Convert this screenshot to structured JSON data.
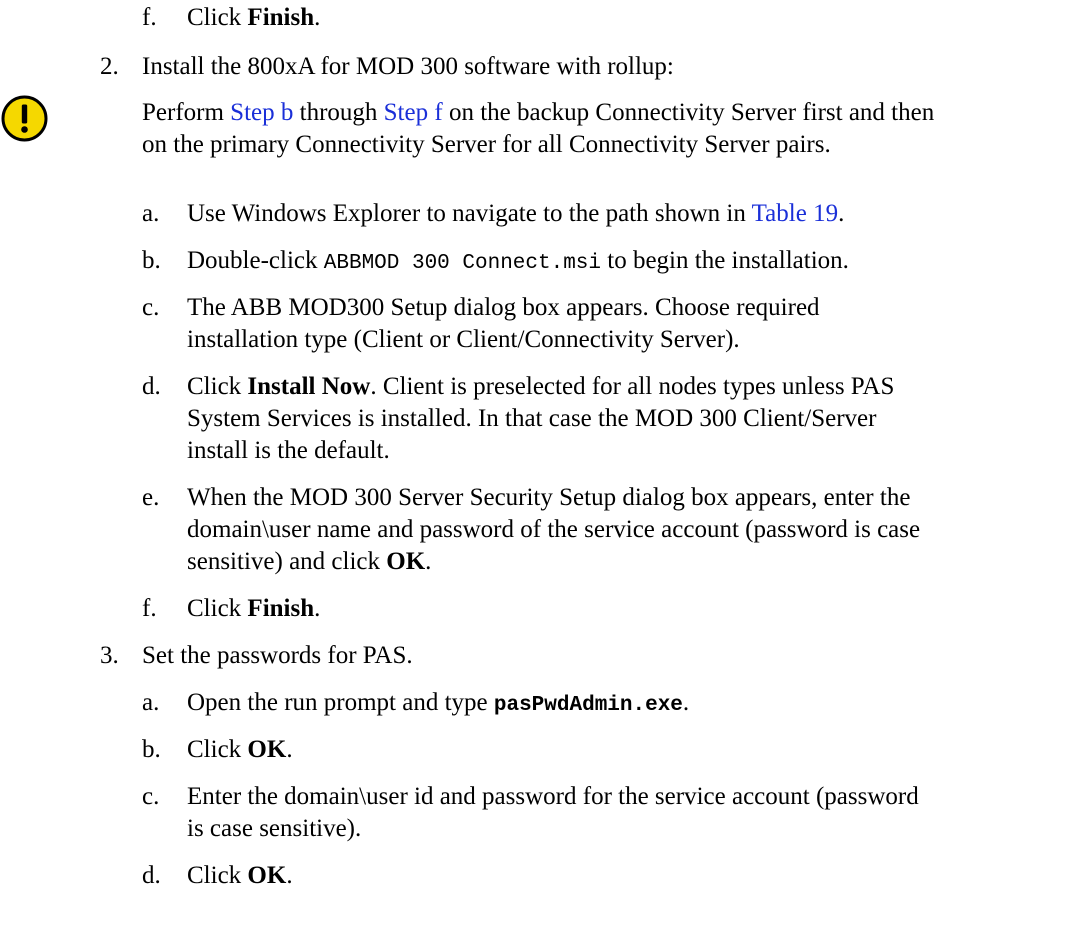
{
  "step1": {
    "f": {
      "marker": "f.",
      "pre": "Click ",
      "bold": "Finish",
      "post": "."
    }
  },
  "step2": {
    "marker": "2.",
    "title": "Install the 800xA for MOD 300 software with rollup:",
    "note": {
      "icon": "warning-icon",
      "icon_color": "#f5d800",
      "pre": "Perform ",
      "link1": "Step b",
      "mid": " through ",
      "link2": "Step f",
      "post1": " on the backup Connectivity Server first and then",
      "line2": "on the primary Connectivity Server for all Connectivity Server pairs."
    },
    "a": {
      "marker": "a.",
      "pre": "Use Windows Explorer to navigate to the path shown in ",
      "link": "Table 19",
      "post": "."
    },
    "b": {
      "marker": "b.",
      "pre": "Double-click ",
      "code": "ABBMOD 300 Connect.msi",
      "post": " to begin the installation."
    },
    "c": {
      "marker": "c.",
      "line1": "The ABB MOD300 Setup dialog box appears. Choose required",
      "line2": "installation type (Client or Client/Connectivity Server)."
    },
    "d": {
      "marker": "d.",
      "pre": "Click ",
      "bold": "Install Now",
      "post": ". Client is preselected for all nodes types unless PAS",
      "line2": "System Services is installed. In that case the MOD 300 Client/Server",
      "line3": "install is the default."
    },
    "e": {
      "marker": "e.",
      "line1": "When the MOD 300 Server Security Setup dialog box appears, enter the",
      "line2": "domain\\user name and password of the service account (password is case",
      "line3_pre": "sensitive) and click ",
      "line3_bold": "OK",
      "line3_post": "."
    },
    "f": {
      "marker": "f.",
      "pre": "Click ",
      "bold": "Finish",
      "post": "."
    }
  },
  "step3": {
    "marker": "3.",
    "title": "Set the passwords for PAS.",
    "a": {
      "marker": "a.",
      "pre": "Open the run prompt and type ",
      "code": "pasPwdAdmin.exe",
      "post": "."
    },
    "b": {
      "marker": "b.",
      "pre": "Click ",
      "bold": "OK",
      "post": "."
    },
    "c": {
      "marker": "c.",
      "line1": "Enter the domain\\user id and password for the service account (password",
      "line2": "is case sensitive)."
    },
    "d": {
      "marker": "d.",
      "pre": "Click ",
      "bold": "OK",
      "post": "."
    }
  }
}
